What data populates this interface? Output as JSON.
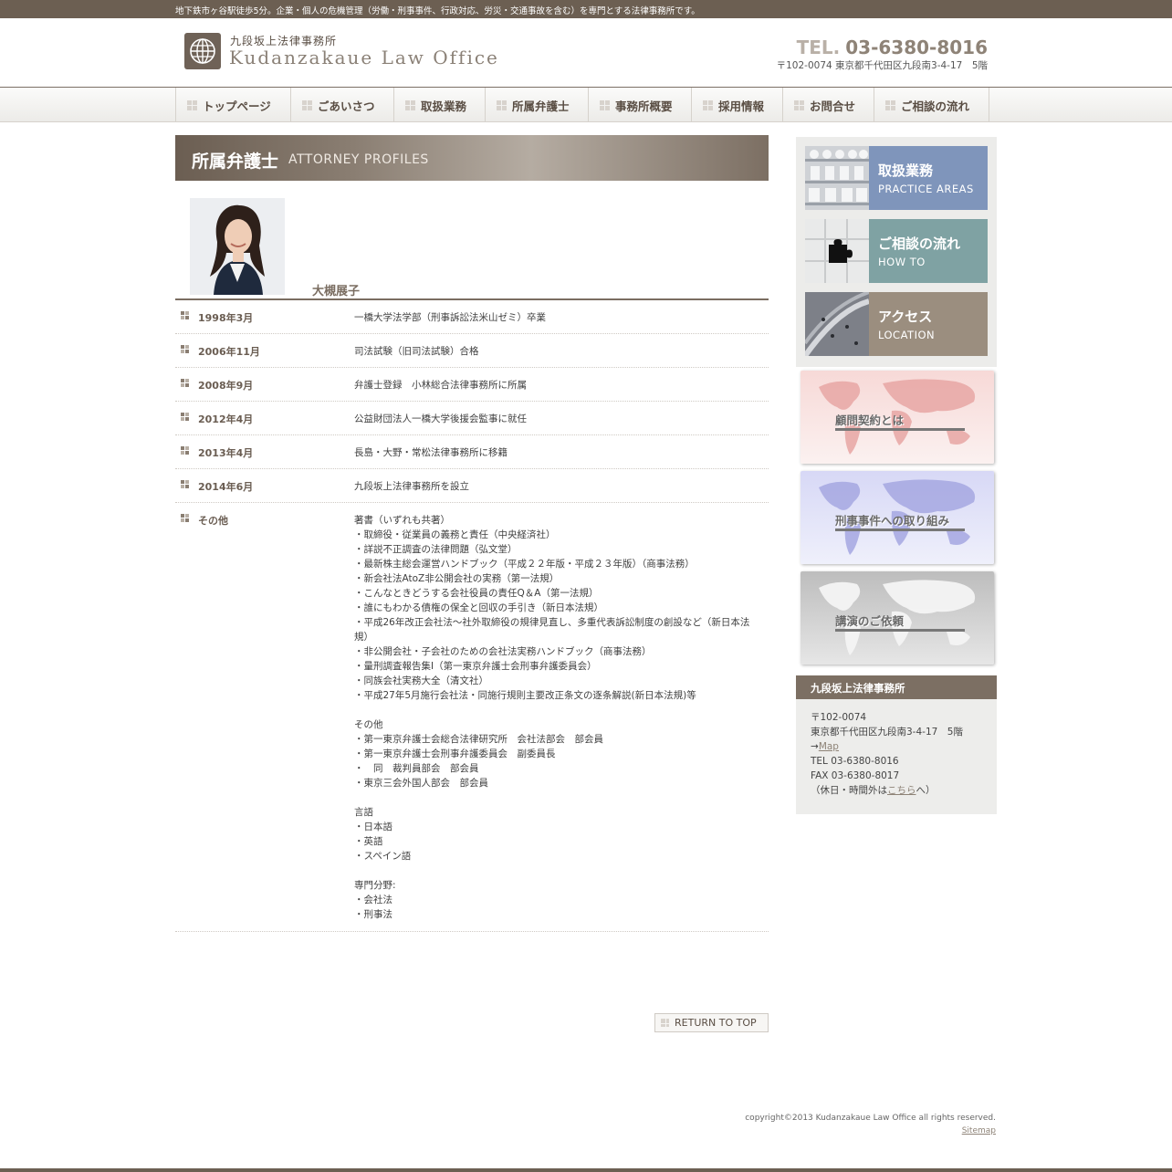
{
  "topbar": {
    "text": "地下鉄市ヶ谷駅徒歩5分。企業・個人の危機管理（労働・刑事事件、行政対応、労災・交通事故を含む）を専門とする法律事務所です。"
  },
  "header": {
    "logo_ja": "九段坂上法律事務所",
    "logo_en": "Kudanzakaue Law Office",
    "tel_label": "TEL.",
    "tel_number": "03-6380-8016",
    "address": "〒102-0074 東京都千代田区九段南3-4-17　5階"
  },
  "nav": [
    {
      "label": "トップページ"
    },
    {
      "label": "ごあいさつ"
    },
    {
      "label": "取扱業務"
    },
    {
      "label": "所属弁護士"
    },
    {
      "label": "事務所概要"
    },
    {
      "label": "採用情報"
    },
    {
      "label": "お問合せ"
    },
    {
      "label": "ご相談の流れ"
    }
  ],
  "page": {
    "title_ja": "所属弁護士",
    "title_en": "ATTORNEY PROFILES"
  },
  "attorney": {
    "name": "大槻展子"
  },
  "career": [
    {
      "date": "1998年3月",
      "text": "一橋大学法学部（刑事訴訟法米山ゼミ）卒業"
    },
    {
      "date": "2006年11月",
      "text": "司法試験（旧司法試験）合格"
    },
    {
      "date": "2008年9月",
      "text": "弁護士登録　小林総合法律事務所に所属"
    },
    {
      "date": "2012年4月",
      "text": "公益財団法人一橋大学後援会監事に就任"
    },
    {
      "date": "2013年4月",
      "text": "長島・大野・常松法律事務所に移籍"
    },
    {
      "date": "2014年6月",
      "text": "九段坂上法律事務所を設立"
    },
    {
      "date": "その他",
      "text": "著書（いずれも共著）\n・取締役・従業員の義務と責任（中央経済社）\n・詳説不正調査の法律問題（弘文堂）\n・最新株主総会運営ハンドブック（平成２２年版・平成２３年版）（商事法務）\n・新会社法AtoZ非公開会社の実務（第一法規）\n・こんなときどうする会社役員の責任Q＆A（第一法規）\n・誰にもわかる債権の保全と回収の手引き（新日本法規）\n・平成26年改正会社法〜社外取締役の規律見直し、多重代表訴訟制度の創設など（新日本法規）\n・非公開会社・子会社のための会社法実務ハンドブック（商事法務）\n・量刑調査報告集Ⅰ（第一東京弁護士会刑事弁護委員会）\n・同族会社実務大全（清文社）\n・平成27年5月施行会社法・同施行規則主要改正条文の逐条解説(新日本法規)等\n\nその他\n・第一東京弁護士会総合法律研究所　会社法部会　部会員\n・第一東京弁護士会刑事弁護委員会　副委員長\n・　同　裁判員部会　部会員\n・東京三会外国人部会　部会員\n\n言語\n・日本語\n・英語\n・スペイン語\n\n専門分野:\n・会社法\n・刑事法"
    }
  ],
  "return_top": "RETURN TO TOP",
  "sidebar": {
    "banners": [
      {
        "ja": "取扱業務",
        "en": "PRACTICE AREAS",
        "color": "#7f95bb"
      },
      {
        "ja": "ご相談の流れ",
        "en": "HOW TO",
        "color": "#7fa2a3"
      },
      {
        "ja": "アクセス",
        "en": "LOCATION",
        "color": "#9b8e7f"
      }
    ],
    "map_banners": [
      {
        "label": "顧問契約とは",
        "color": "#f3c5c3"
      },
      {
        "label": "刑事事件への取り組み",
        "color": "#c3c6f3"
      },
      {
        "label": "講演のご依頼",
        "color": "#c9c9c9"
      }
    ],
    "office": {
      "title": "九段坂上法律事務所",
      "zip": "〒102-0074",
      "address": "東京都千代田区九段南3-4-17　5階",
      "map_prefix": "→",
      "map_link": "Map",
      "tel": "TEL 03-6380-8016",
      "fax": "FAX 03-6380-8017",
      "offhours_prefix": "（休日・時間外は",
      "offhours_link": "こちら",
      "offhours_suffix": "へ）"
    }
  },
  "footer": {
    "copyright": "copyright©2013 Kudanzakaue Law Office all rights reserved.",
    "sitemap": "Sitemap"
  }
}
